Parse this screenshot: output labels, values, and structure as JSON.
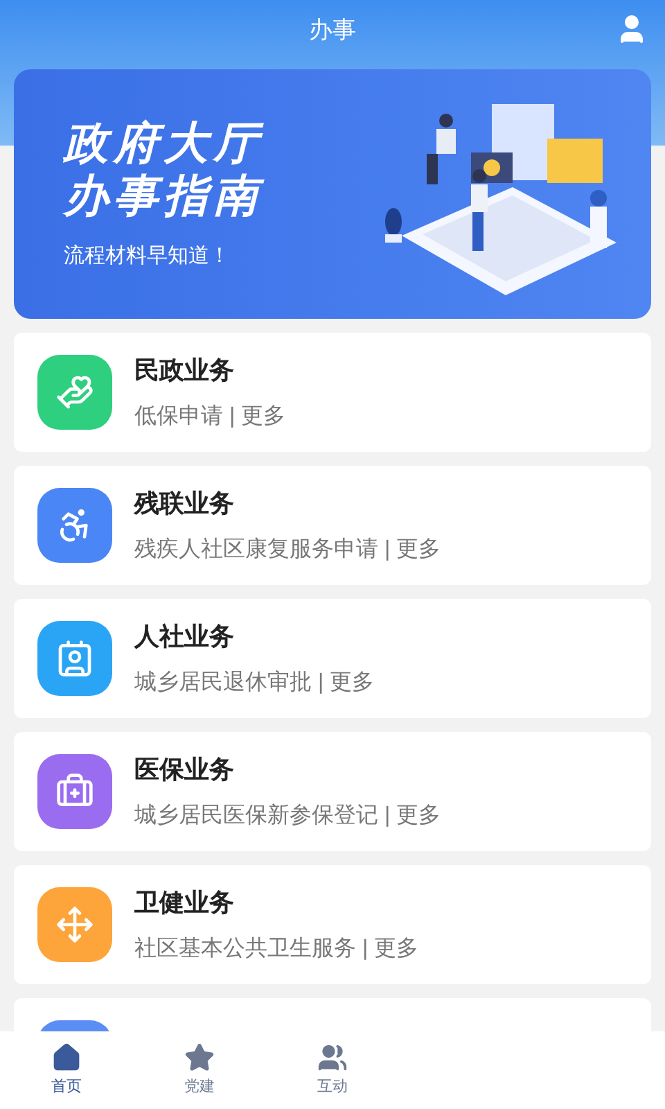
{
  "header": {
    "title": "办事"
  },
  "banner": {
    "title_lines": [
      "政府大厅",
      "办事指南"
    ],
    "subtitle": "流程材料早知道！"
  },
  "services": [
    {
      "title": "民政业务",
      "subtitle": "低保申请 | 更多",
      "color": "#2ecf7e"
    },
    {
      "title": "残联业务",
      "subtitle": "残疾人社区康复服务申请 | 更多",
      "color": "#4a86f5"
    },
    {
      "title": "人社业务",
      "subtitle": "城乡居民退休审批 | 更多",
      "color": "#2aa5f5"
    },
    {
      "title": "医保业务",
      "subtitle": "城乡居民医保新参保登记 | 更多",
      "color": "#9a6cf0"
    },
    {
      "title": "卫健业务",
      "subtitle": "社区基本公共卫生服务 | 更多",
      "color": "#fda43a"
    },
    {
      "color": "#5b8ef5"
    }
  ],
  "nav": [
    {
      "label": "首页",
      "selected": true
    },
    {
      "label": "党建",
      "selected": false
    },
    {
      "label": "互动",
      "selected": false
    }
  ]
}
